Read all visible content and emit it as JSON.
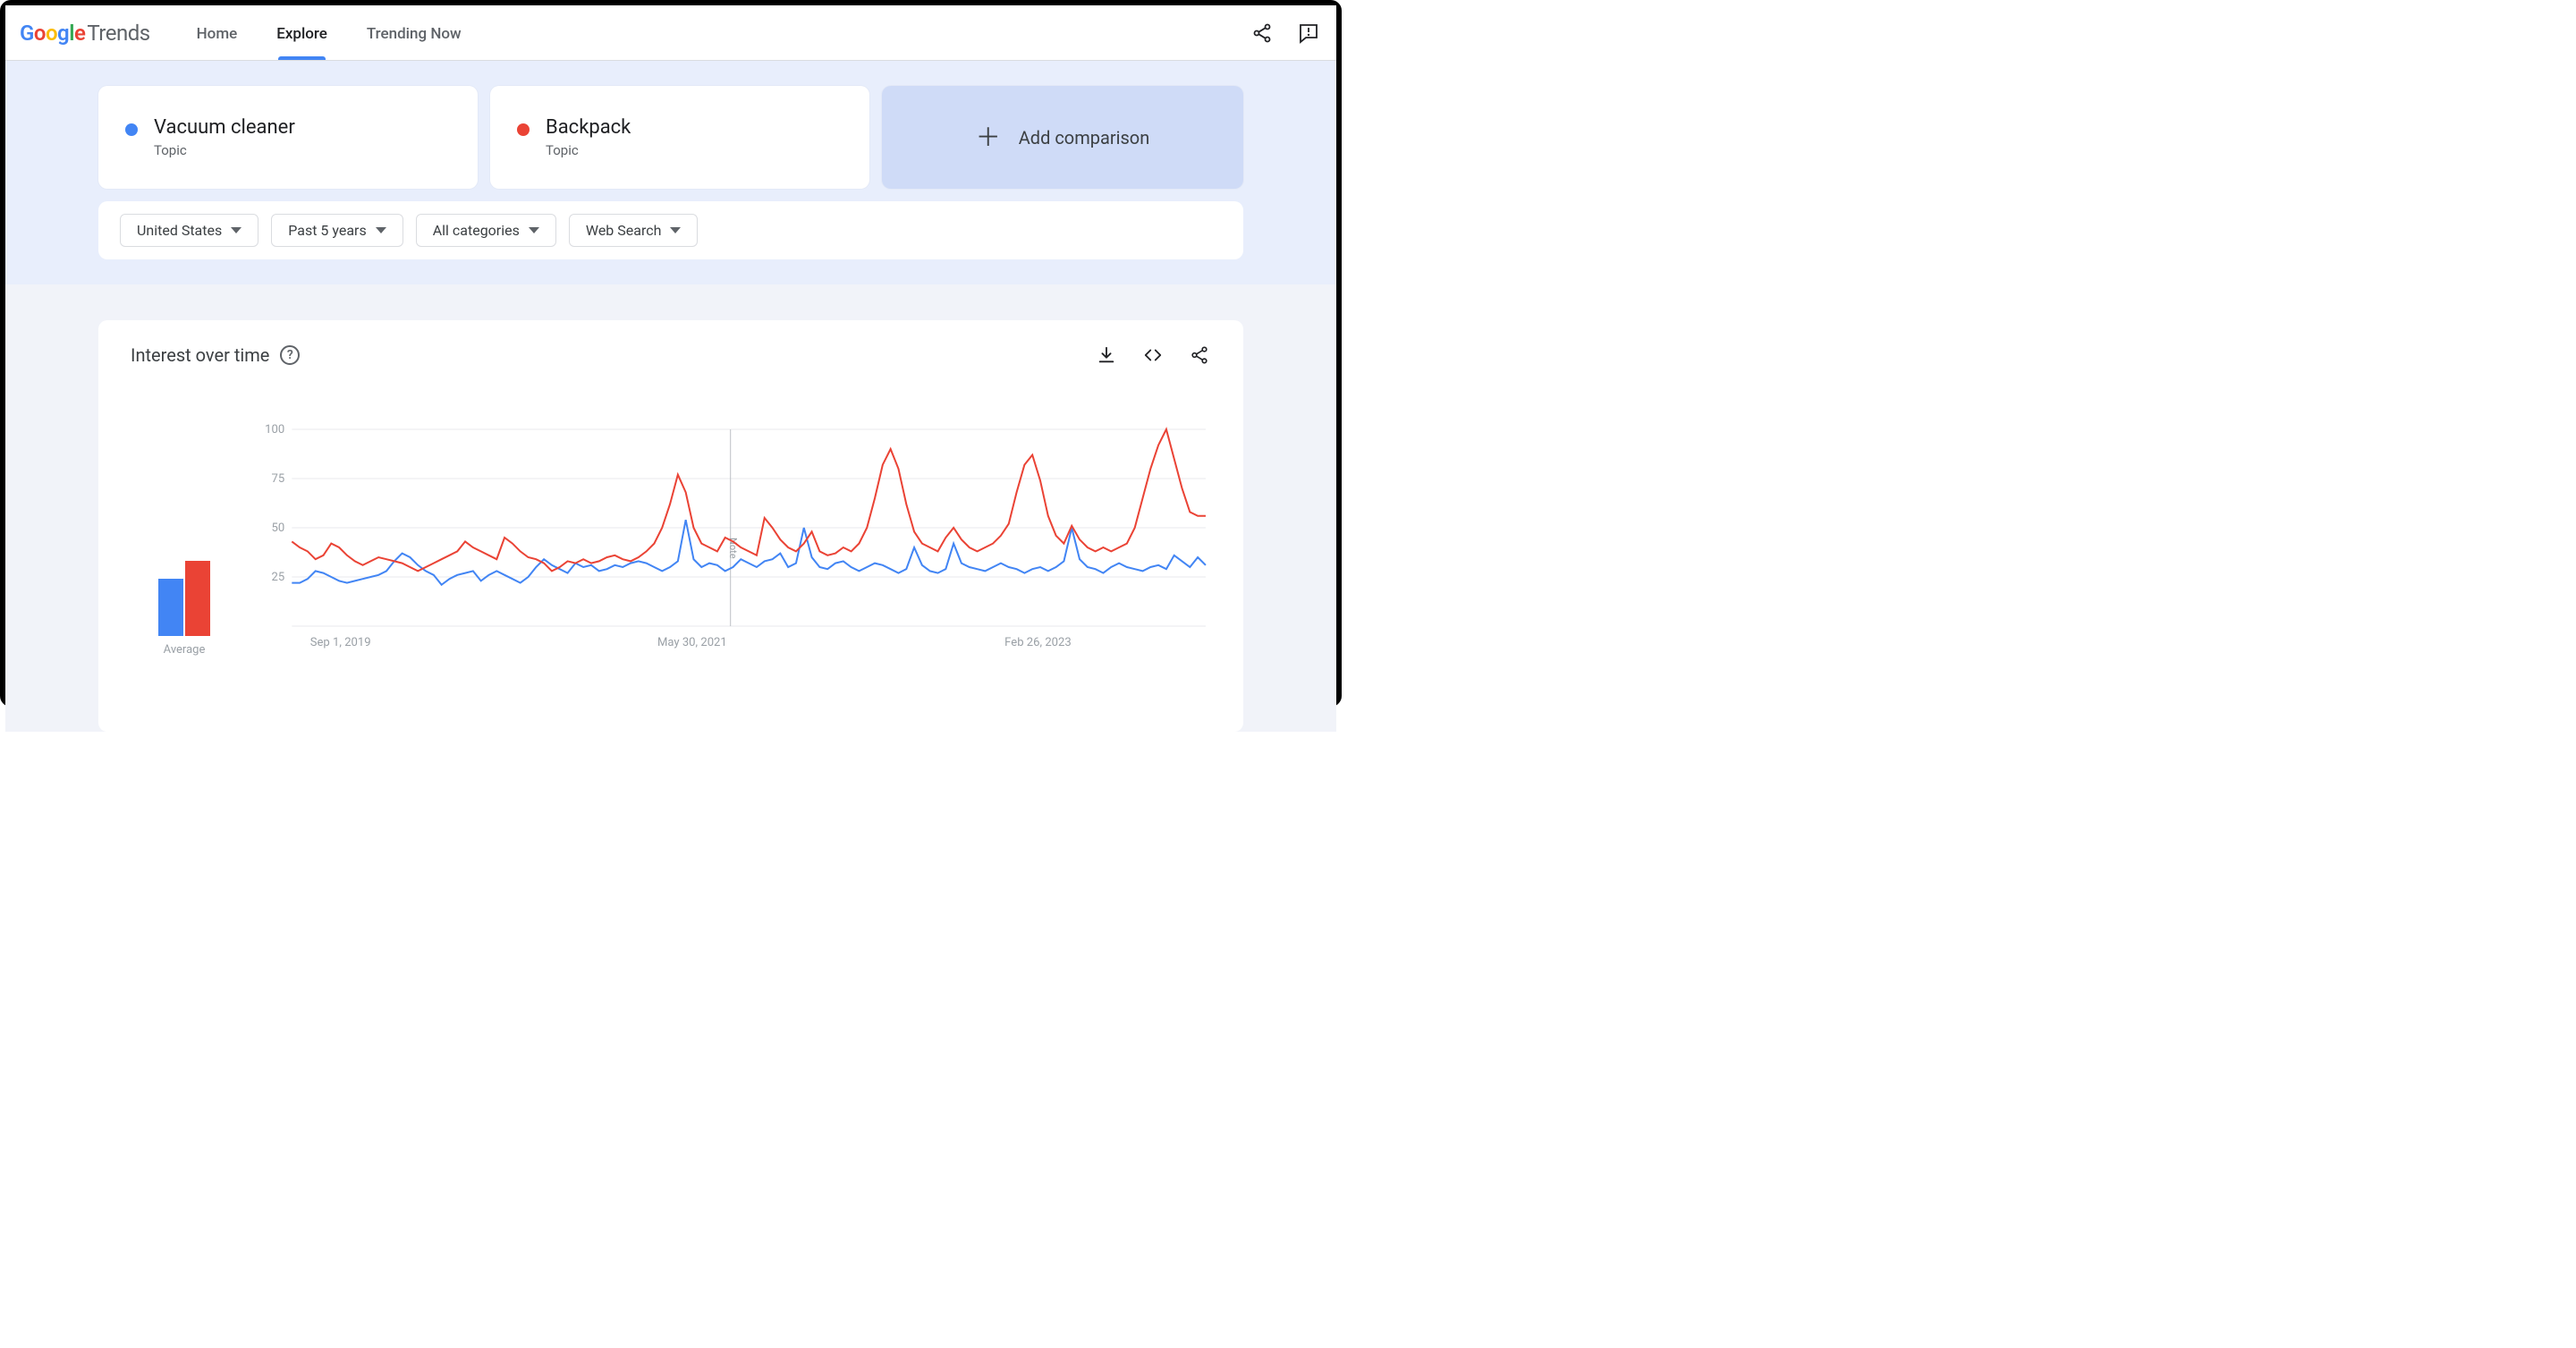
{
  "header": {
    "logo_trends": "Trends",
    "nav": [
      "Home",
      "Explore",
      "Trending Now"
    ],
    "active_nav_index": 1
  },
  "compare": {
    "terms": [
      {
        "title": "Vacuum cleaner",
        "subtitle": "Topic",
        "color": "#4285F4"
      },
      {
        "title": "Backpack",
        "subtitle": "Topic",
        "color": "#EA4335"
      }
    ],
    "add_label": "Add comparison"
  },
  "filters": {
    "geo": "United States",
    "time": "Past 5 years",
    "category": "All categories",
    "search_type": "Web Search"
  },
  "chart": {
    "title": "Interest over time",
    "average_label": "Average",
    "note_label": "Note"
  },
  "chart_data": {
    "type": "line",
    "ylim": [
      0,
      100
    ],
    "y_ticks": [
      25,
      50,
      75,
      100
    ],
    "x_tick_labels": [
      "Sep 1, 2019",
      "May 30, 2021",
      "Feb 26, 2023"
    ],
    "x_tick_positions_pct": [
      2,
      40,
      78
    ],
    "note_position_pct": 48,
    "averages": {
      "Vacuum cleaner": 29,
      "Backpack": 38
    },
    "series": [
      {
        "name": "Vacuum cleaner",
        "color": "#4285F4",
        "values": [
          22,
          22,
          24,
          28,
          27,
          25,
          23,
          22,
          23,
          24,
          25,
          26,
          28,
          33,
          37,
          35,
          31,
          28,
          26,
          21,
          24,
          26,
          27,
          28,
          23,
          26,
          28,
          26,
          24,
          22,
          25,
          30,
          34,
          31,
          29,
          27,
          32,
          30,
          31,
          28,
          29,
          31,
          30,
          32,
          33,
          32,
          30,
          28,
          30,
          33,
          54,
          34,
          30,
          32,
          31,
          28,
          30,
          34,
          32,
          30,
          33,
          34,
          37,
          30,
          32,
          50,
          35,
          30,
          29,
          32,
          33,
          30,
          28,
          30,
          32,
          31,
          29,
          27,
          29,
          40,
          31,
          28,
          27,
          29,
          42,
          32,
          30,
          29,
          28,
          30,
          32,
          30,
          29,
          27,
          29,
          30,
          28,
          30,
          33,
          50,
          34,
          30,
          29,
          27,
          30,
          32,
          30,
          29,
          28,
          30,
          31,
          29,
          36,
          33,
          30,
          35,
          31
        ]
      },
      {
        "name": "Backpack",
        "color": "#EA4335",
        "values": [
          43,
          40,
          38,
          34,
          36,
          42,
          40,
          36,
          33,
          31,
          33,
          35,
          34,
          33,
          32,
          30,
          28,
          30,
          32,
          34,
          36,
          38,
          43,
          40,
          38,
          36,
          34,
          45,
          42,
          38,
          35,
          34,
          32,
          28,
          30,
          33,
          32,
          34,
          32,
          33,
          35,
          36,
          34,
          33,
          35,
          38,
          42,
          50,
          62,
          77,
          68,
          50,
          42,
          40,
          38,
          45,
          43,
          40,
          38,
          36,
          55,
          50,
          44,
          40,
          38,
          42,
          48,
          38,
          36,
          37,
          40,
          38,
          42,
          50,
          65,
          82,
          90,
          80,
          62,
          48,
          42,
          40,
          38,
          45,
          50,
          44,
          40,
          38,
          40,
          42,
          46,
          52,
          68,
          82,
          87,
          74,
          56,
          46,
          42,
          51,
          44,
          40,
          38,
          40,
          38,
          40,
          42,
          50,
          65,
          80,
          92,
          100,
          85,
          70,
          58,
          56,
          56
        ]
      }
    ]
  }
}
